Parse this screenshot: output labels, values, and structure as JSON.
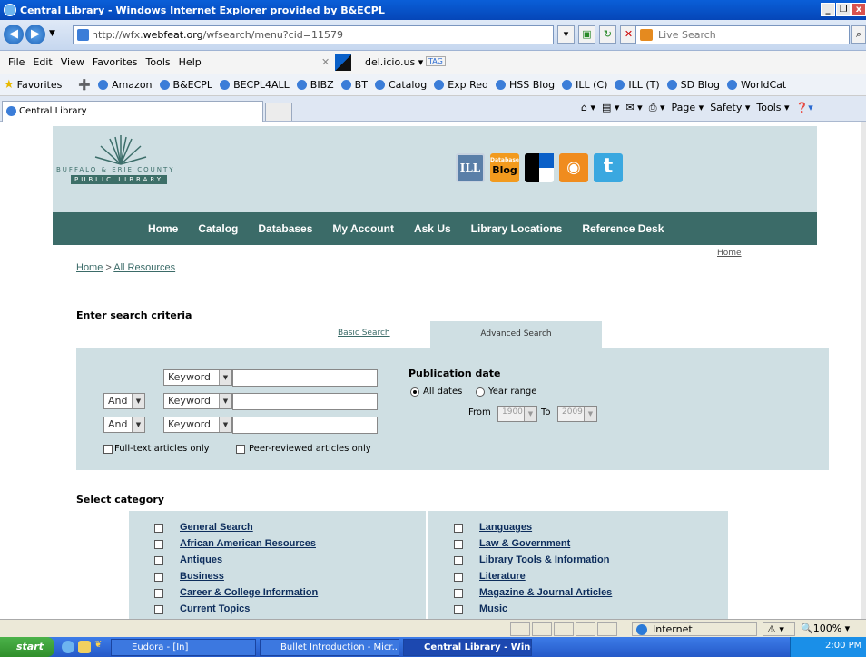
{
  "window": {
    "title": "Central Library - Windows Internet Explorer provided by B&ECPL"
  },
  "address": {
    "url_prefix": "http://wfx.",
    "url_host": "webfeat.org",
    "url_path": "/wfsearch/menu?cid=11579",
    "search_placeholder": "Live Search"
  },
  "menu": [
    "File",
    "Edit",
    "View",
    "Favorites",
    "Tools",
    "Help"
  ],
  "toolbar": {
    "delicious": "del.icio.us",
    "tag": "TAG"
  },
  "favorites": {
    "label": "Favorites",
    "items": [
      "Amazon",
      "B&ECPL",
      "BECPL4ALL",
      "BIBZ",
      "BT",
      "Catalog",
      "Exp Req",
      "HSS Blog",
      "ILL (C)",
      "ILL (T)",
      "SD Blog",
      "WorldCat"
    ]
  },
  "tab": {
    "title": "Central Library"
  },
  "commands": {
    "page": "Page",
    "safety": "Safety",
    "tools": "Tools"
  },
  "library": {
    "name_line1": "BUFFALO & ERIE COUNTY",
    "name_line2": "PUBLIC LIBRARY",
    "icon_ill": "ILL",
    "icon_db_top": "Database",
    "icon_db_bottom": "Blog"
  },
  "nav": [
    "Home",
    "Catalog",
    "Databases",
    "My Account",
    "Ask Us",
    "Library Locations",
    "Reference Desk"
  ],
  "home_link": "Home",
  "breadcrumb": {
    "home": "Home",
    "sep": " > ",
    "current": "All Resources"
  },
  "search": {
    "heading": "Enter search criteria",
    "basic_tab": "Basic Search",
    "advanced_tab": "Advanced Search",
    "field1": "Keyword",
    "field2": "Keyword",
    "field3": "Keyword",
    "op2": "And",
    "op3": "And",
    "fulltext": "Full-text articles only",
    "peer": "Peer-reviewed articles only",
    "pubdate_heading": "Publication date",
    "all_dates": "All dates",
    "year_range": "Year range",
    "from": "From",
    "from_value": "1900",
    "to": "To",
    "to_value": "2009"
  },
  "category": {
    "heading": "Select category",
    "left": [
      "General Search",
      "African American Resources",
      "Antiques",
      "Business",
      "Career & College Information",
      "Current Topics"
    ],
    "right": [
      "Languages",
      "Law & Government",
      "Library Tools & Information",
      "Literature",
      "Magazine & Journal Articles",
      "Music"
    ]
  },
  "status": {
    "zone": "Internet",
    "zoom": "100%"
  },
  "taskbar": {
    "start": "start",
    "tasks": [
      "Eudora - [In]",
      "Bullet Introduction - Micr...",
      "Central Library - Wind..."
    ],
    "clock": "2:00 PM"
  }
}
